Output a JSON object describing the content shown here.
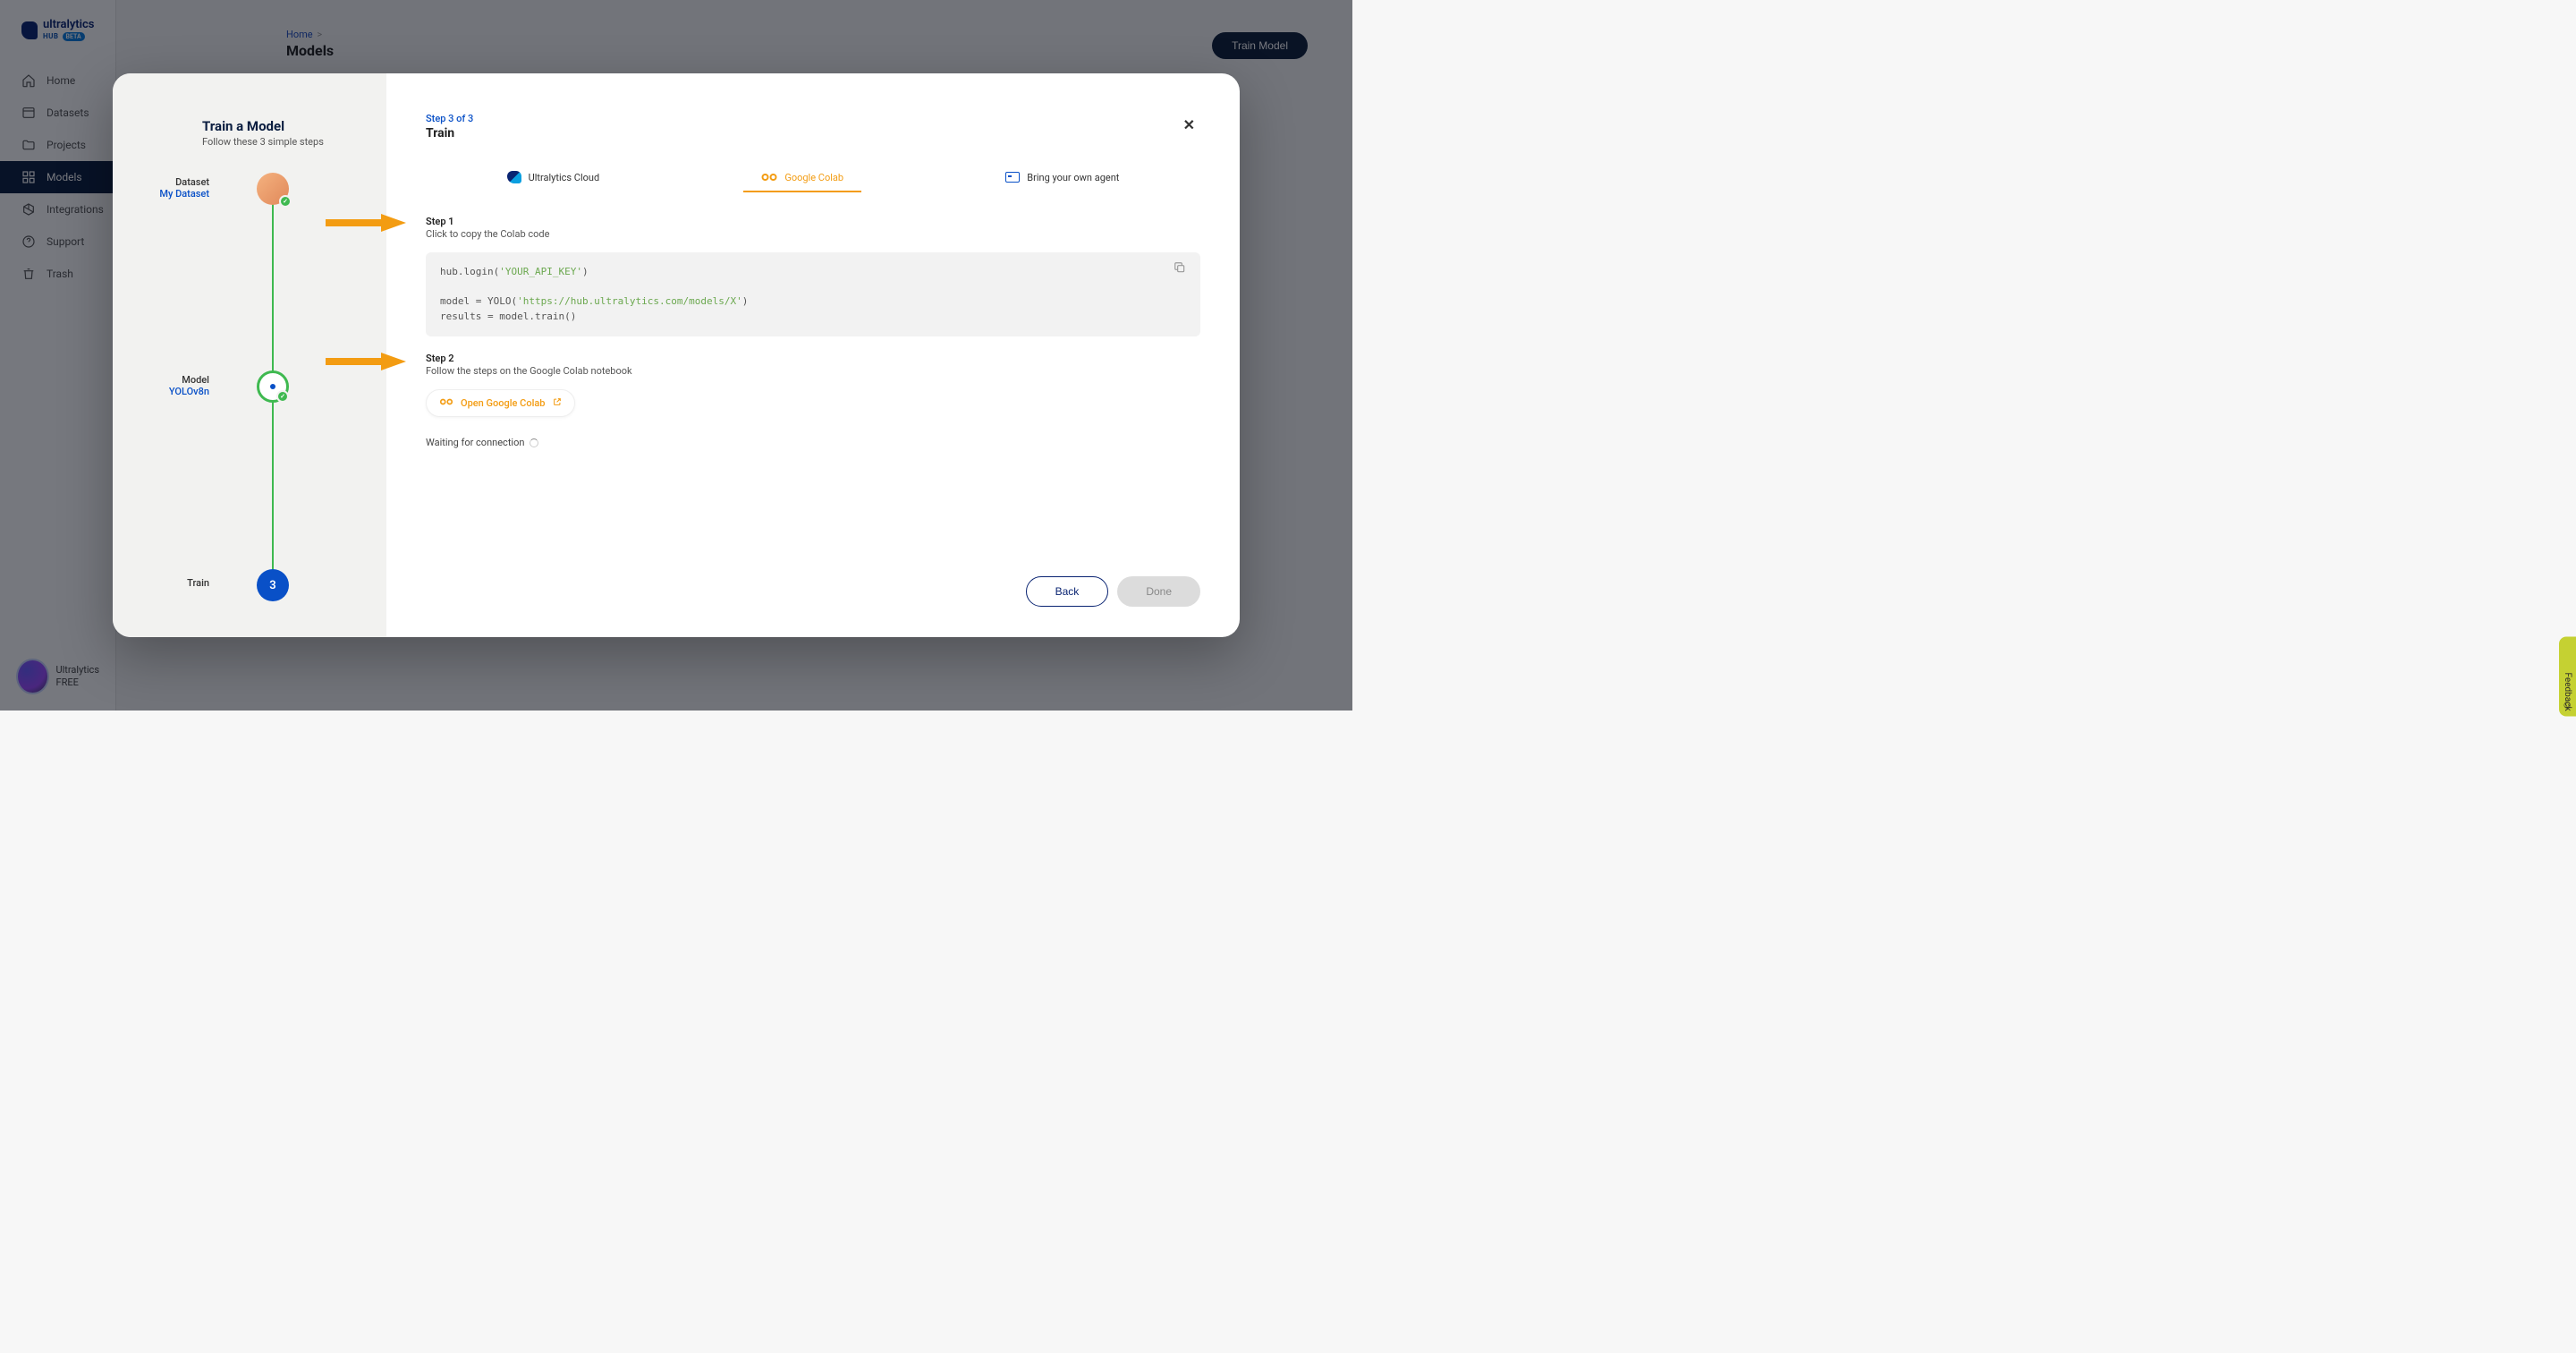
{
  "brand": {
    "name": "ultralytics",
    "sub": "HUB",
    "badge": "BETA"
  },
  "nav": {
    "items": [
      {
        "label": "Home",
        "icon": "home-icon"
      },
      {
        "label": "Datasets",
        "icon": "datasets-icon"
      },
      {
        "label": "Projects",
        "icon": "projects-icon"
      },
      {
        "label": "Models",
        "icon": "models-icon",
        "active": true
      },
      {
        "label": "Integrations",
        "icon": "integrations-icon"
      },
      {
        "label": "Support",
        "icon": "support-icon"
      },
      {
        "label": "Trash",
        "icon": "trash-icon"
      }
    ]
  },
  "user": {
    "name": "Ultralytics",
    "plan": "FREE"
  },
  "page": {
    "breadcrumb_home": "Home",
    "title": "Models",
    "train_button": "Train Model"
  },
  "modal": {
    "title": "Train a Model",
    "subtitle": "Follow these 3 simple steps",
    "timeline": {
      "dataset": {
        "head": "Dataset",
        "sub": "My Dataset"
      },
      "model": {
        "head": "Model",
        "sub": "YOLOv8n"
      },
      "train": {
        "head": "Train",
        "number": "3"
      }
    },
    "right": {
      "step_indicator": "Step 3 of 3",
      "step_title": "Train",
      "tabs": [
        {
          "label": "Ultralytics Cloud"
        },
        {
          "label": "Google Colab",
          "active": true
        },
        {
          "label": "Bring your own agent"
        }
      ],
      "step1": {
        "label": "Step 1",
        "desc": "Click to copy the Colab code"
      },
      "code": {
        "line1_a": "hub.login(",
        "line1_b": "'YOUR_API_KEY'",
        "line1_c": ")",
        "line3_a": "model = YOLO(",
        "line3_b": "'https://hub.ultralytics.com/models/X'",
        "line3_c": ")",
        "line4": "results = model.train()"
      },
      "step2": {
        "label": "Step 2",
        "desc": "Follow the steps on the Google Colab notebook"
      },
      "open_colab": "Open Google Colab",
      "waiting": "Waiting for connection",
      "back": "Back",
      "done": "Done"
    }
  },
  "feedback": "Feedback"
}
